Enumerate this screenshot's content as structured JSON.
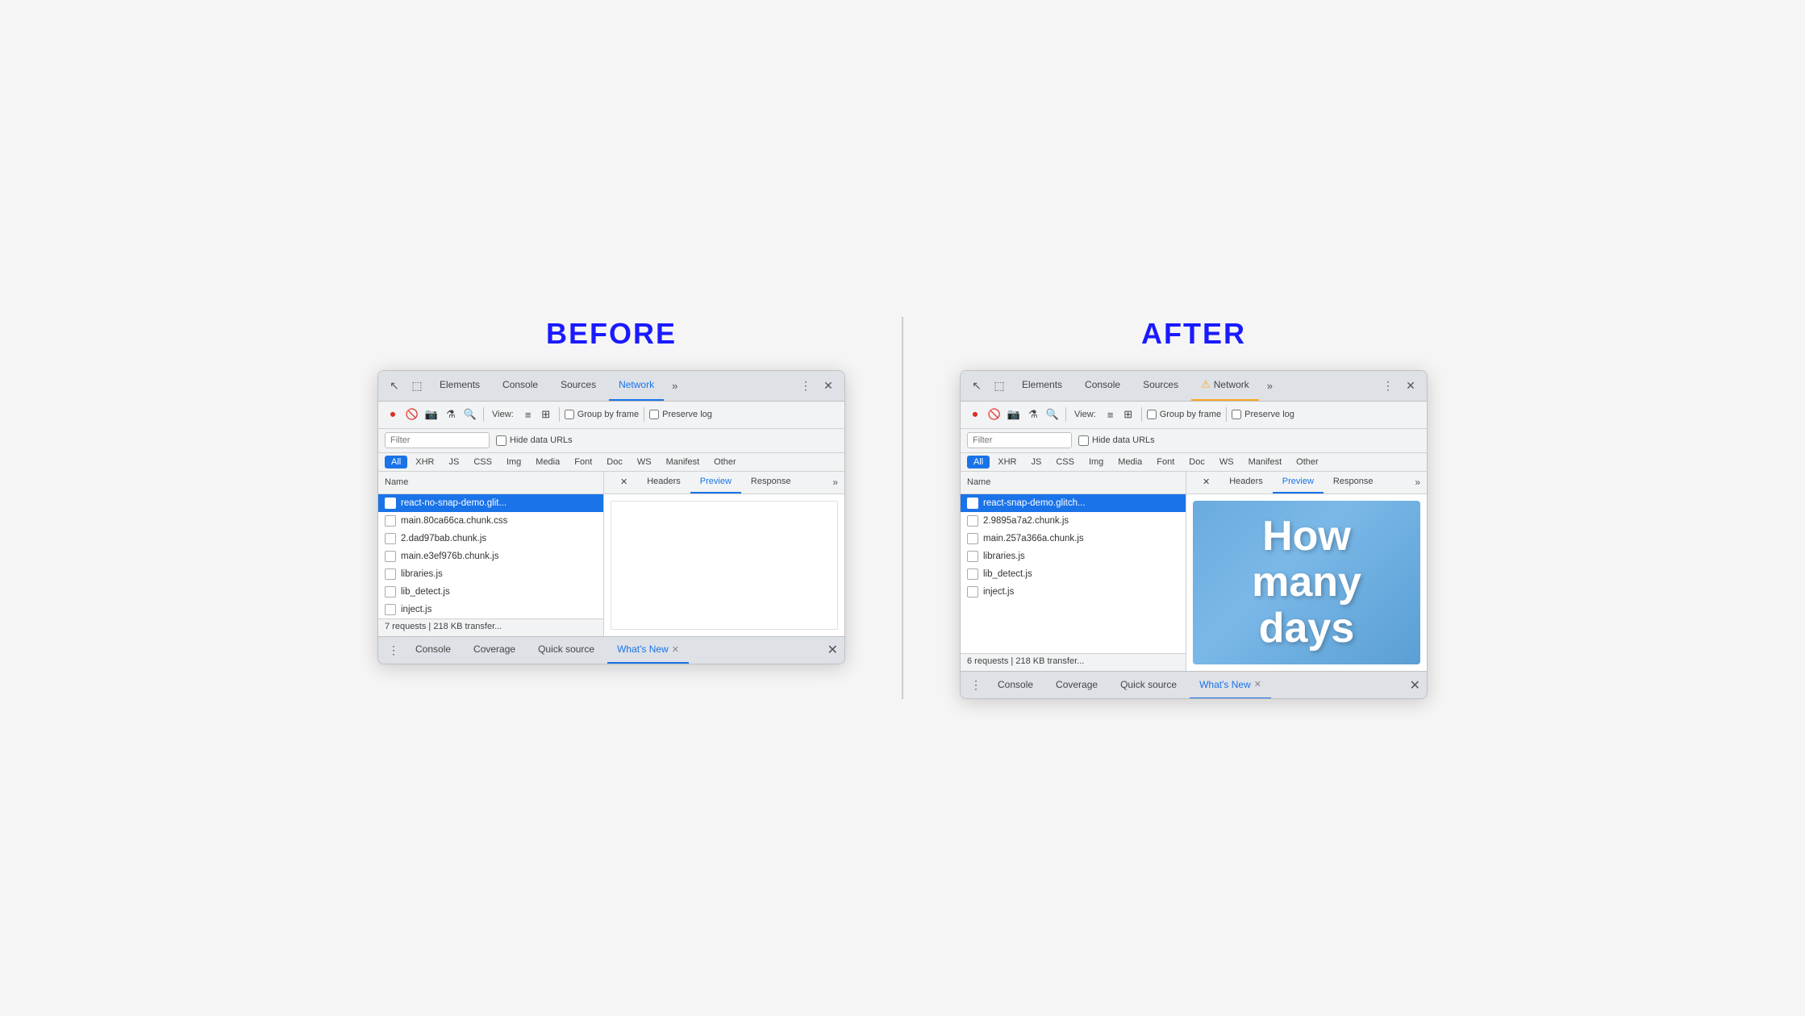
{
  "before": {
    "label": "BEFORE",
    "tabs": {
      "items": [
        "Elements",
        "Console",
        "Sources",
        "Network"
      ],
      "active": "Network",
      "active_warning": false
    },
    "toolbar": {
      "view_label": "View:",
      "group_by_frame": "Group by frame",
      "preserve_log": "Preserve log"
    },
    "filter": {
      "placeholder": "Filter",
      "hide_data_urls": "Hide data URLs"
    },
    "filter_types": [
      "All",
      "XHR",
      "JS",
      "CSS",
      "Img",
      "Media",
      "Font",
      "Doc",
      "WS",
      "Manifest",
      "Other"
    ],
    "active_filter": "All",
    "name_column": "Name",
    "panel_tabs": [
      "Headers",
      "Preview",
      "Response"
    ],
    "active_panel_tab": "Preview",
    "files": [
      {
        "name": "react-no-snap-demo.glit...",
        "selected": true
      },
      {
        "name": "main.80ca66ca.chunk.css",
        "selected": false
      },
      {
        "name": "2.dad97bab.chunk.js",
        "selected": false
      },
      {
        "name": "main.e3ef976b.chunk.js",
        "selected": false
      },
      {
        "name": "libraries.js",
        "selected": false
      },
      {
        "name": "lib_detect.js",
        "selected": false
      },
      {
        "name": "inject.js",
        "selected": false
      }
    ],
    "status": "7 requests | 218 KB transfer...",
    "preview": "empty",
    "bottom_tabs": [
      "Console",
      "Coverage",
      "Quick source",
      "What's New"
    ],
    "active_bottom_tab": "What's New"
  },
  "after": {
    "label": "AFTER",
    "tabs": {
      "items": [
        "Elements",
        "Console",
        "Sources",
        "Network"
      ],
      "active": "Network",
      "active_warning": true
    },
    "toolbar": {
      "view_label": "View:",
      "group_by_frame": "Group by frame",
      "preserve_log": "Preserve log"
    },
    "filter": {
      "placeholder": "Filter",
      "hide_data_urls": "Hide data URLs"
    },
    "filter_types": [
      "All",
      "XHR",
      "JS",
      "CSS",
      "Img",
      "Media",
      "Font",
      "Doc",
      "WS",
      "Manifest",
      "Other"
    ],
    "active_filter": "All",
    "name_column": "Name",
    "panel_tabs": [
      "Headers",
      "Preview",
      "Response"
    ],
    "active_panel_tab": "Preview",
    "files": [
      {
        "name": "react-snap-demo.glitch...",
        "selected": true
      },
      {
        "name": "2.9895a7a2.chunk.js",
        "selected": false
      },
      {
        "name": "main.257a366a.chunk.js",
        "selected": false
      },
      {
        "name": "libraries.js",
        "selected": false
      },
      {
        "name": "lib_detect.js",
        "selected": false
      },
      {
        "name": "inject.js",
        "selected": false
      }
    ],
    "status": "6 requests | 218 KB transfer...",
    "preview": "image",
    "preview_text": "How many days",
    "bottom_tabs": [
      "Console",
      "Coverage",
      "Quick source",
      "What's New"
    ],
    "active_bottom_tab": "What's New"
  },
  "icons": {
    "record": "⏺",
    "no": "🚫",
    "camera": "📷",
    "funnel": "⚗",
    "search": "🔍",
    "cursor": "↖",
    "inspect": "⬚",
    "more_vert": "⋮",
    "close": "✕",
    "chevron_right": "»",
    "menu": "⋮"
  }
}
